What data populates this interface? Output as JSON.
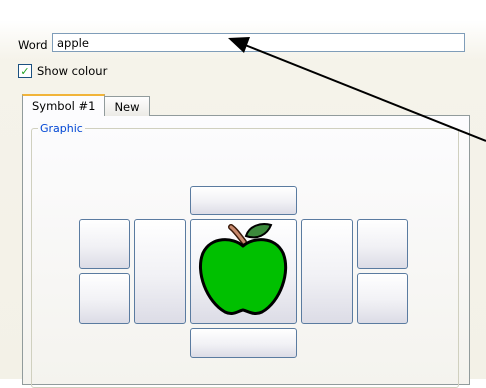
{
  "word": {
    "label": "Word",
    "value": "apple"
  },
  "show_colour": {
    "label": "Show colour",
    "checked": true
  },
  "tabs": [
    {
      "label": "Symbol #1",
      "active": true
    },
    {
      "label": "New",
      "active": false
    }
  ],
  "graphic": {
    "legend": "Graphic",
    "image": "green-apple-icon",
    "apple_color": "#00c000",
    "stem_color": "#9b4a2a",
    "leaf_color": "#3c8a3c"
  },
  "colors": {
    "legend": "#0046d5",
    "button_border": "#5a7ba0",
    "arrow": "#000000"
  }
}
